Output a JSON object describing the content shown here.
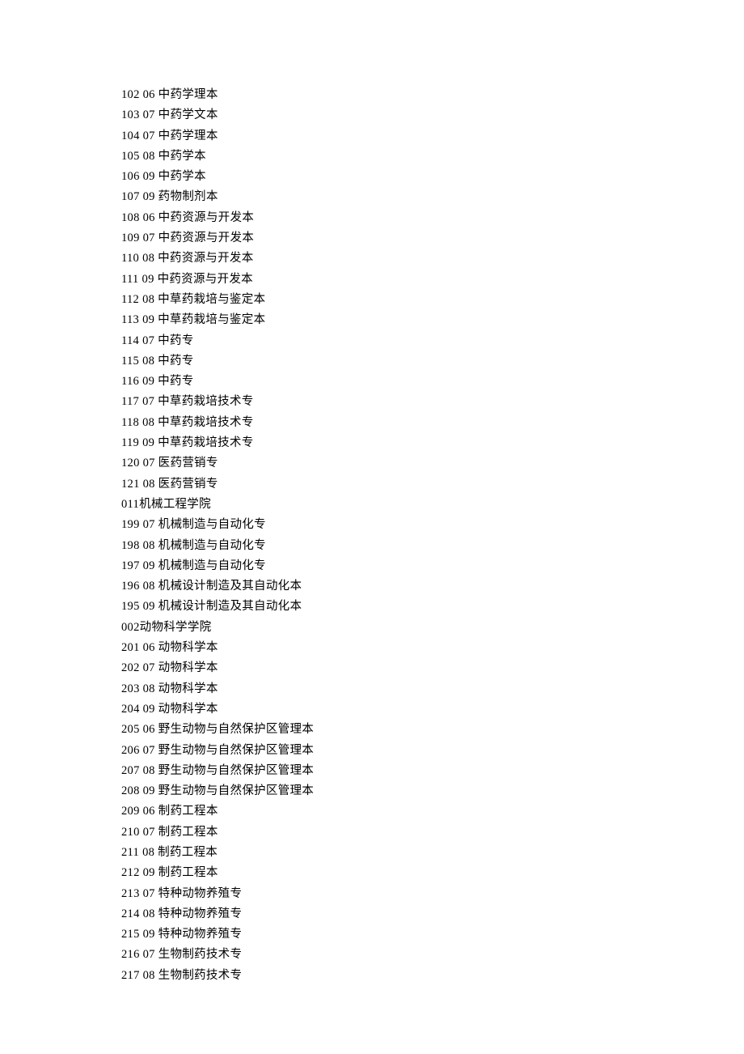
{
  "rows": [
    {
      "type": "item",
      "code": "102",
      "year": "06",
      "name": "中药学理本"
    },
    {
      "type": "item",
      "code": "103",
      "year": "07",
      "name": "中药学文本"
    },
    {
      "type": "item",
      "code": "104",
      "year": "07",
      "name": "中药学理本"
    },
    {
      "type": "item",
      "code": "105",
      "year": "08",
      "name": "中药学本"
    },
    {
      "type": "item",
      "code": "106",
      "year": "09",
      "name": "中药学本"
    },
    {
      "type": "item",
      "code": "107",
      "year": "09",
      "name": "药物制剂本"
    },
    {
      "type": "item",
      "code": "108",
      "year": "06",
      "name": "中药资源与开发本"
    },
    {
      "type": "item",
      "code": "109",
      "year": "07",
      "name": "中药资源与开发本"
    },
    {
      "type": "item",
      "code": "110",
      "year": "08",
      "name": "中药资源与开发本"
    },
    {
      "type": "item",
      "code": "111",
      "year": "09",
      "name": "中药资源与开发本"
    },
    {
      "type": "item",
      "code": "112",
      "year": "08",
      "name": "中草药栽培与鉴定本"
    },
    {
      "type": "item",
      "code": "113",
      "year": "09",
      "name": "中草药栽培与鉴定本"
    },
    {
      "type": "item",
      "code": "114",
      "year": "07",
      "name": "中药专"
    },
    {
      "type": "item",
      "code": "115",
      "year": "08",
      "name": "中药专"
    },
    {
      "type": "item",
      "code": "116",
      "year": "09",
      "name": "中药专"
    },
    {
      "type": "item",
      "code": "117",
      "year": "07",
      "name": "中草药栽培技术专"
    },
    {
      "type": "item",
      "code": "118",
      "year": "08",
      "name": "中草药栽培技术专"
    },
    {
      "type": "item",
      "code": "119",
      "year": "09",
      "name": "中草药栽培技术专"
    },
    {
      "type": "item",
      "code": "120",
      "year": "07",
      "name": "医药营销专"
    },
    {
      "type": "item",
      "code": "121",
      "year": "08",
      "name": "医药营销专"
    },
    {
      "type": "header",
      "text": "011机械工程学院"
    },
    {
      "type": "item",
      "code": "199",
      "year": "07",
      "name": "机械制造与自动化专"
    },
    {
      "type": "item",
      "code": "198",
      "year": "08",
      "name": "机械制造与自动化专"
    },
    {
      "type": "item",
      "code": "197",
      "year": "09",
      "name": "机械制造与自动化专"
    },
    {
      "type": "item",
      "code": "196",
      "year": "08",
      "name": "机械设计制造及其自动化本"
    },
    {
      "type": "item",
      "code": "195",
      "year": "09",
      "name": "机械设计制造及其自动化本"
    },
    {
      "type": "header",
      "text": "002动物科学学院"
    },
    {
      "type": "item",
      "code": "201",
      "year": "06",
      "name": "动物科学本"
    },
    {
      "type": "item",
      "code": "202",
      "year": "07",
      "name": "动物科学本"
    },
    {
      "type": "item",
      "code": "203",
      "year": "08",
      "name": "动物科学本"
    },
    {
      "type": "item",
      "code": "204",
      "year": "09",
      "name": "动物科学本"
    },
    {
      "type": "item",
      "code": "205",
      "year": "06",
      "name": "野生动物与自然保护区管理本"
    },
    {
      "type": "item",
      "code": "206",
      "year": "07",
      "name": "野生动物与自然保护区管理本"
    },
    {
      "type": "item",
      "code": "207",
      "year": "08",
      "name": "野生动物与自然保护区管理本"
    },
    {
      "type": "item",
      "code": "208",
      "year": "09",
      "name": "野生动物与自然保护区管理本"
    },
    {
      "type": "item",
      "code": "209",
      "year": "06",
      "name": "制药工程本"
    },
    {
      "type": "item",
      "code": "210",
      "year": "07",
      "name": "制药工程本"
    },
    {
      "type": "item",
      "code": "211",
      "year": "08",
      "name": "制药工程本"
    },
    {
      "type": "item",
      "code": "212",
      "year": "09",
      "name": "制药工程本"
    },
    {
      "type": "item",
      "code": "213",
      "year": "07",
      "name": "特种动物养殖专"
    },
    {
      "type": "item",
      "code": "214",
      "year": "08",
      "name": "特种动物养殖专"
    },
    {
      "type": "item",
      "code": "215",
      "year": "09",
      "name": "特种动物养殖专"
    },
    {
      "type": "item",
      "code": "216",
      "year": "07",
      "name": "生物制药技术专"
    },
    {
      "type": "item",
      "code": "217",
      "year": "08",
      "name": "生物制药技术专"
    }
  ]
}
